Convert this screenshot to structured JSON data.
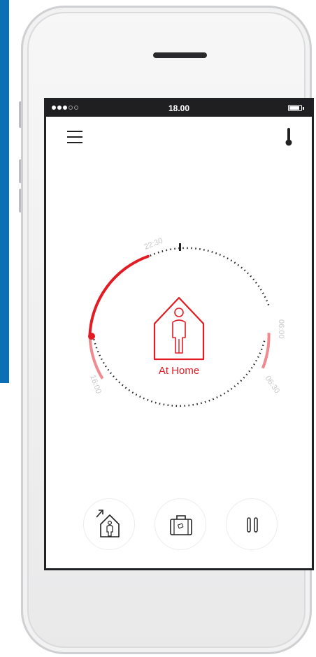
{
  "status_bar": {
    "time": "18.00",
    "signal_dots": 5,
    "signal_filled": 3
  },
  "colors": {
    "accent": "#e31b23",
    "accent_light": "#f08a8f",
    "status_bar_bg": "#1f1f21",
    "side_strip": "#0a6fb4"
  },
  "header": {
    "menu_icon": "hamburger-menu-icon",
    "right_icon": "thermometer-icon"
  },
  "dial": {
    "mode_label": "At Home",
    "mode_icon": "house-person-icon",
    "time_labels": [
      "22:30",
      "06:00",
      "06:30",
      "16:00"
    ]
  },
  "bottom_bar": {
    "buttons": [
      {
        "name": "home-away-button",
        "icon": "house-arrow-icon"
      },
      {
        "name": "vacation-button",
        "icon": "suitcase-icon"
      },
      {
        "name": "pause-button",
        "icon": "pause-icon"
      }
    ]
  }
}
